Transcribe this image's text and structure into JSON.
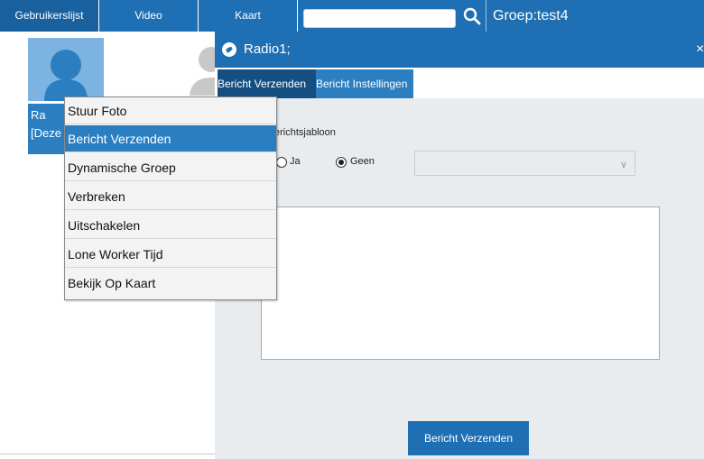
{
  "nav": {
    "tabs": [
      "Gebruikerslijst",
      "Video",
      "Kaart"
    ],
    "search": {
      "value": "",
      "placeholder": ""
    },
    "group_label": "Groep:test4"
  },
  "user": {
    "name_line1": "Ra",
    "name_line2": "[Deze"
  },
  "dialog": {
    "title": "Radio1;",
    "close": "×",
    "tabs": [
      "Bericht Verzenden",
      "Bericht Instellingen"
    ],
    "template_label": "erichtsjabloon",
    "radio_yes": "Ja",
    "radio_no": "Geen",
    "radio_selected": "Geen",
    "template_select": "",
    "message": "",
    "send_button": "Bericht Verzenden"
  },
  "context_menu": {
    "items": [
      "Stuur Foto",
      "Bericht Verzenden",
      "Dynamische Groep",
      "Verbreken",
      "Uitschakelen",
      "Lone Worker Tijd",
      "Bekijk Op Kaart"
    ],
    "highlighted": "Bericht Verzenden"
  },
  "colors": {
    "primary": "#1e6fb4",
    "highlight": "#2b7fc1",
    "active_tab": "#154f82"
  },
  "icons": [
    "search-icon",
    "user-avatar-icon",
    "bird-icon",
    "close-icon",
    "chevron-down-icon"
  ]
}
